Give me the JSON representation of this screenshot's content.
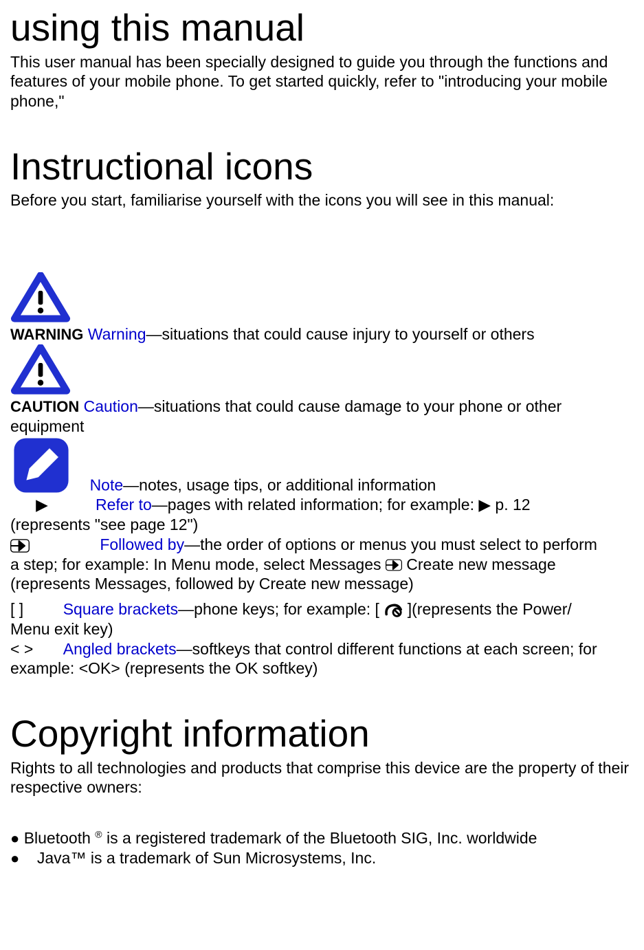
{
  "title1": "using this manual",
  "intro1": "This user manual has been specially designed to guide you through the functions and features of your mobile phone. To get started quickly, refer to \"introducing your mobile phone,\"",
  "title2": "Instructional icons",
  "intro2": "Before you start, familiarise yourself with the icons you will see in this manual:",
  "warning_label": "WARNING",
  "warning_term": "Warning",
  "warning_text": "—situations that could cause injury to yourself or others",
  "caution_label": "CAUTION",
  "caution_term": "Caution",
  "caution_text_a": "—situations that could cause damage to your phone or other",
  "caution_text_b": "equipment",
  "note_term": "Note",
  "note_text": "—notes, usage tips, or additional information",
  "refer_symbol": "▶",
  "refer_term": "Refer to",
  "refer_text_a": "—pages with related information; for example: ▶ p. 12",
  "refer_text_b": "(represents \"see page 12\")",
  "followed_term": "Followed by",
  "followed_text_a": "—the order of options or menus you must select to perform",
  "followed_text_b": "a step; for example: In Menu mode, select Messages ",
  "followed_text_c": " Create new message",
  "followed_text_d": "(represents Messages, followed by Create new message)",
  "square_symbol": "[  ]",
  "square_term": "Square brackets",
  "square_text_a": "—phone keys; for example: [",
  "square_text_b": " ](represents the Power/",
  "square_text_c": "Menu exit key)",
  "angled_symbol": "<  >",
  "angled_term": "Angled brackets",
  "angled_text_a": "—softkeys that control different functions at each screen; for",
  "angled_text_b": "example: <OK> (represents the OK softkey)",
  "title3": "Copyright information",
  "intro3": "Rights to all technologies and products that comprise this device are the property of their respective owners:",
  "bullet1_a": "Bluetooth ",
  "bullet1_sup": "®",
  "bullet1_b": " is a registered trademark of the Bluetooth SIG, Inc. worldwide",
  "bullet2": "Java™ is a trademark of Sun Microsystems, Inc."
}
